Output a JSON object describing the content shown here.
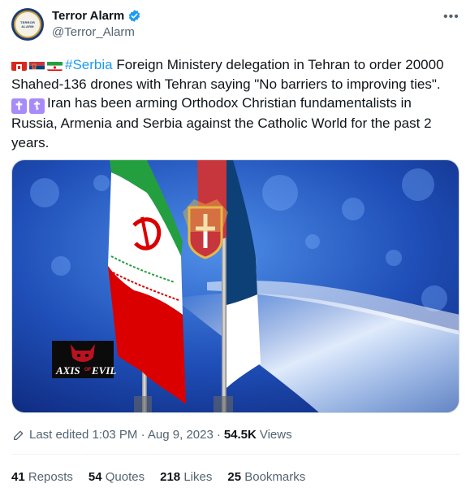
{
  "author": {
    "display_name": "Terror Alarm",
    "handle": "@Terror_Alarm",
    "avatar_text": [
      "TERROR",
      "ALARM"
    ]
  },
  "tweet": {
    "hashtag": "#Serbia",
    "line1_rest": " Foreign Ministery delegation in Tehran to order 20000",
    "line2": "Shahed-136 drones with Tehran saying \"No barriers to improving ties\".",
    "line3_rest": "Iran has been arming Orthodox Christian fundamentalists in",
    "line4": "Russia, Armenia and Serbia against the Catholic World for the past 2",
    "line5": "years.",
    "cross_glyphs": [
      "✝",
      "☦"
    ]
  },
  "media": {
    "logo_word_1": "AXIS",
    "logo_word_2": "OF",
    "logo_word_3": "EVIL",
    "colors": {
      "iran_green": "#239f40",
      "iran_red": "#da0000",
      "serbia_red": "#c6363c",
      "serbia_blue": "#0c4076"
    }
  },
  "meta": {
    "edited": "Last edited 1:03 PM · Aug 9, 2023",
    "separator": "·",
    "views_count": "54.5K",
    "views_label": "Views"
  },
  "stats": {
    "reposts_count": "41",
    "reposts_label": "Reposts",
    "quotes_count": "54",
    "quotes_label": "Quotes",
    "likes_count": "218",
    "likes_label": "Likes",
    "bookmarks_count": "25",
    "bookmarks_label": "Bookmarks"
  },
  "colors": {
    "link": "#1d9bf0",
    "verified": "#1d9bf0",
    "secondary_text": "#536471"
  },
  "icons": {
    "verified": "verified-badge-icon",
    "more": "more-icon",
    "edit": "edit-icon"
  }
}
